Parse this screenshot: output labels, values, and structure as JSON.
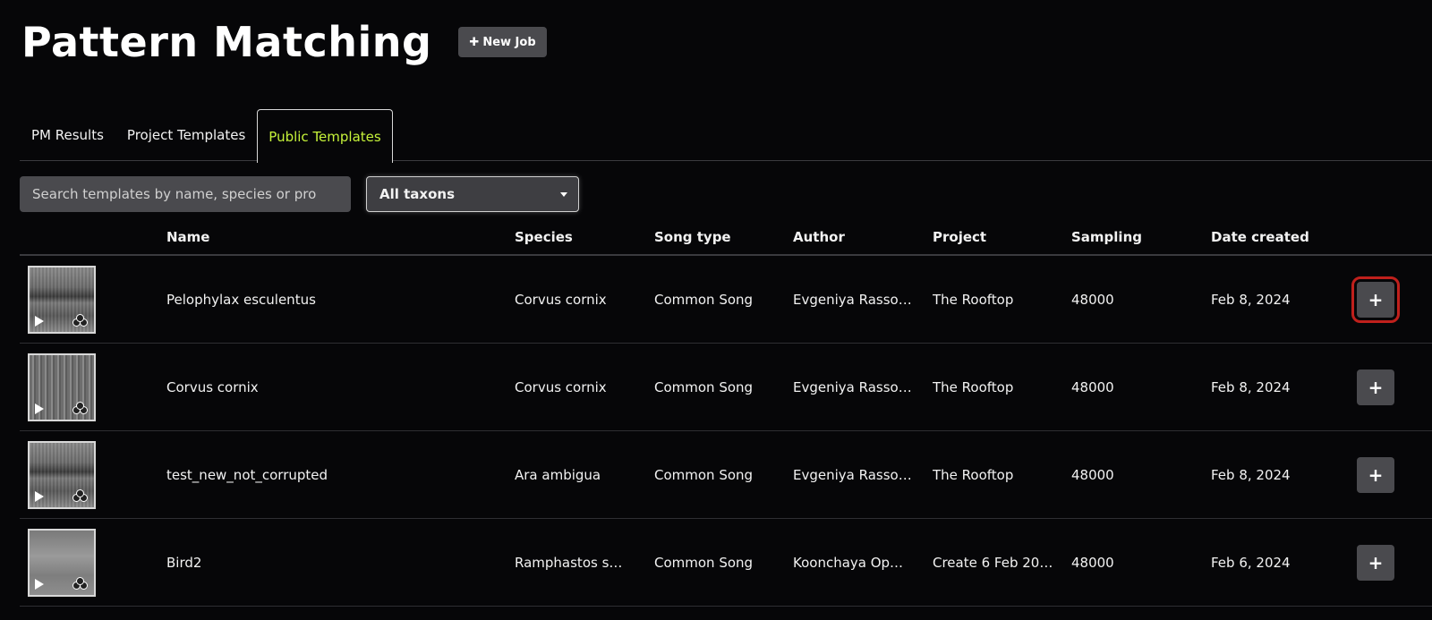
{
  "header": {
    "title": "Pattern Matching",
    "new_job_label": "New Job",
    "new_job_icon": "plus-icon"
  },
  "tabs": [
    {
      "label": "PM Results",
      "active": false
    },
    {
      "label": "Project Templates",
      "active": false
    },
    {
      "label": "Public Templates",
      "active": true
    }
  ],
  "filters": {
    "search_placeholder": "Search templates by name, species or pro",
    "taxon_selected": "All taxons"
  },
  "table": {
    "columns": [
      "Name",
      "Species",
      "Song type",
      "Author",
      "Project",
      "Sampling",
      "Date created"
    ],
    "rows": [
      {
        "name": "Pelophylax esculentus",
        "species": "Corvus cornix",
        "song_type": "Common Song",
        "author": "Evgeniya Rasso…",
        "project": "The Rooftop",
        "sampling": "48000",
        "date": "Feb 8, 2024",
        "action": "+"
      },
      {
        "name": "Corvus cornix",
        "species": "Corvus cornix",
        "song_type": "Common Song",
        "author": "Evgeniya Rasso…",
        "project": "The Rooftop",
        "sampling": "48000",
        "date": "Feb 8, 2024",
        "action": "+"
      },
      {
        "name": "test_new_not_corrupted",
        "species": "Ara ambigua",
        "song_type": "Common Song",
        "author": "Evgeniya Rasso…",
        "project": "The Rooftop",
        "sampling": "48000",
        "date": "Feb 8, 2024",
        "action": "+"
      },
      {
        "name": "Bird2",
        "species": "Ramphastos s…",
        "song_type": "Common Song",
        "author": "Koonchaya Op…",
        "project": "Create 6 Feb 20…",
        "sampling": "48000",
        "date": "Feb 6, 2024",
        "action": "+"
      }
    ]
  },
  "colors": {
    "accent_active_tab": "#c6f33a",
    "highlight": "#c0201c",
    "button_bg": "#4a4a4e",
    "background": "#060608"
  }
}
